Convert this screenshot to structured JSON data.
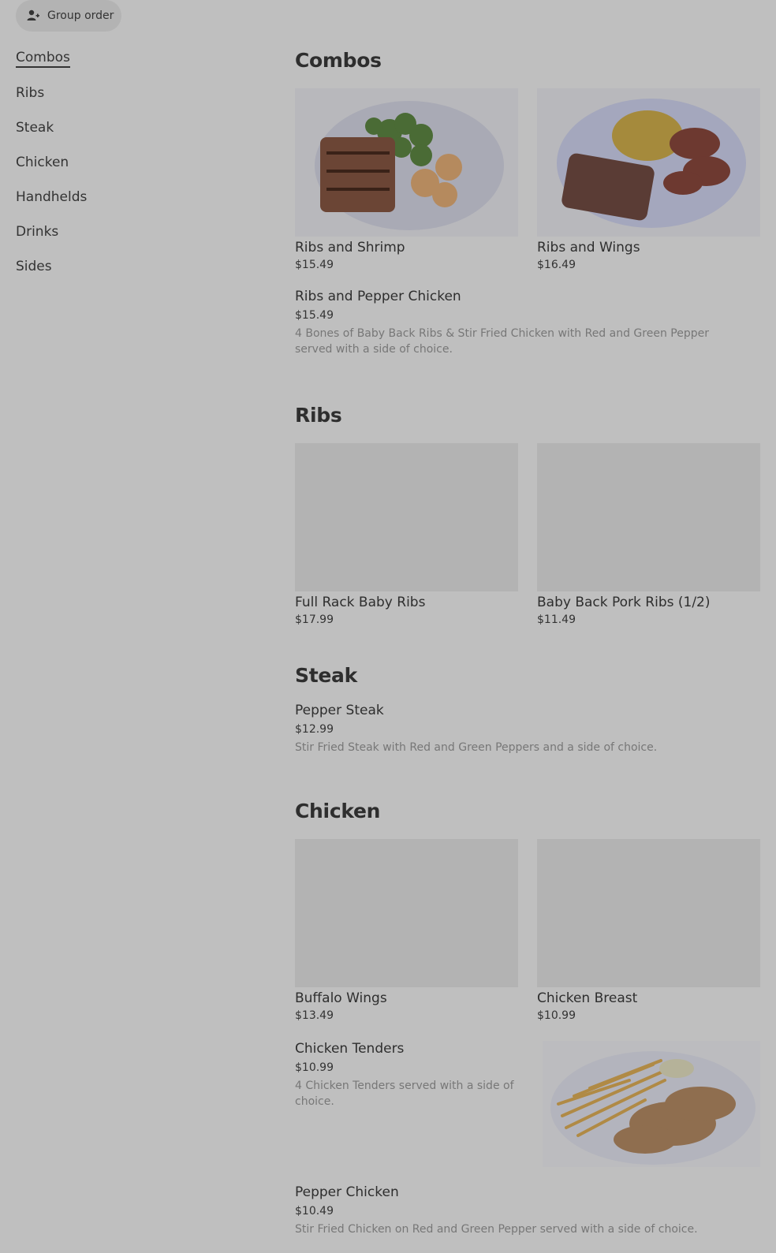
{
  "header": {
    "group_order_label": "Group order",
    "group_order_icon": "person-plus-icon"
  },
  "sidebar": {
    "items": [
      {
        "label": "Combos",
        "active": true
      },
      {
        "label": "Ribs"
      },
      {
        "label": "Steak"
      },
      {
        "label": "Chicken"
      },
      {
        "label": "Handhelds"
      },
      {
        "label": "Drinks"
      },
      {
        "label": "Sides"
      }
    ]
  },
  "sections": {
    "combos": {
      "title": "Combos",
      "items": [
        {
          "name": "Ribs and Shrimp",
          "price": "$15.49"
        },
        {
          "name": "Ribs and Wings",
          "price": "$16.49"
        },
        {
          "name": "Ribs and Pepper Chicken",
          "price": "$15.49",
          "description": "4 Bones of Baby Back Ribs & Stir Fried Chicken with Red and Green Pepper served with a side of choice."
        }
      ]
    },
    "ribs": {
      "title": "Ribs",
      "items": [
        {
          "name": "Full Rack Baby Ribs",
          "price": "$17.99"
        },
        {
          "name": "Baby Back Pork Ribs (1/2)",
          "price": "$11.49"
        }
      ]
    },
    "steak": {
      "title": "Steak",
      "items": [
        {
          "name": "Pepper Steak",
          "price": "$12.99",
          "description": "Stir Fried Steak with Red and Green Peppers and a side of choice."
        }
      ]
    },
    "chicken": {
      "title": "Chicken",
      "items": [
        {
          "name": "Buffalo Wings",
          "price": "$13.49"
        },
        {
          "name": "Chicken Breast",
          "price": "$10.99"
        },
        {
          "name": "Chicken Tenders",
          "price": "$10.99",
          "description": "4 Chicken Tenders served with a side of choice."
        },
        {
          "name": "Pepper Chicken",
          "price": "$10.49",
          "description": "Stir Fried Chicken on Red and Green Pepper served with a side of choice."
        }
      ]
    }
  }
}
